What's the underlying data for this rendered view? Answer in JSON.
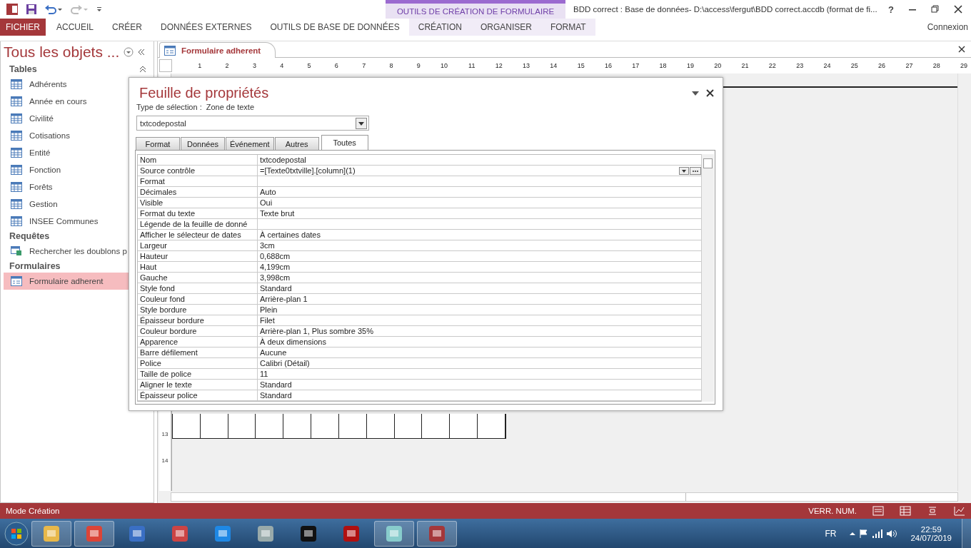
{
  "window": {
    "title": "BDD correct : Base de données- D:\\access\\fergut\\BDD correct.accdb (format de fi...",
    "help": "?",
    "account": "Connexion"
  },
  "ribbon": {
    "contextual_group": "OUTILS DE CRÉATION DE FORMULAIRE",
    "tabs": [
      {
        "label": "FICHIER",
        "kind": "file"
      },
      {
        "label": "ACCUEIL",
        "kind": "normal"
      },
      {
        "label": "CRÉER",
        "kind": "normal"
      },
      {
        "label": "DONNÉES EXTERNES",
        "kind": "normal"
      },
      {
        "label": "OUTILS DE BASE DE DONNÉES",
        "kind": "normal"
      },
      {
        "label": "CRÉATION",
        "kind": "contextual"
      },
      {
        "label": "ORGANISER",
        "kind": "contextual"
      },
      {
        "label": "FORMAT",
        "kind": "contextual"
      }
    ]
  },
  "nav_pane": {
    "title": "Tous les objets ...",
    "groups": [
      {
        "label": "Tables",
        "items": [
          {
            "label": "Adhérents",
            "kind": "table",
            "selected": false
          },
          {
            "label": "Année en cours",
            "kind": "table",
            "selected": false
          },
          {
            "label": "Civilité",
            "kind": "table",
            "selected": false
          },
          {
            "label": "Cotisations",
            "kind": "table",
            "selected": false
          },
          {
            "label": "Entité",
            "kind": "table",
            "selected": false
          },
          {
            "label": "Fonction",
            "kind": "table",
            "selected": false
          },
          {
            "label": "Forêts",
            "kind": "table",
            "selected": false
          },
          {
            "label": "Gestion",
            "kind": "table",
            "selected": false
          },
          {
            "label": "INSEE Communes",
            "kind": "table",
            "selected": false
          }
        ]
      },
      {
        "label": "Requêtes",
        "items": [
          {
            "label": "Rechercher les doublons p",
            "kind": "query",
            "selected": false
          }
        ]
      },
      {
        "label": "Formulaires",
        "items": [
          {
            "label": "Formulaire adherent",
            "kind": "form",
            "selected": true
          }
        ]
      }
    ]
  },
  "document": {
    "tab": "Formulaire adherent",
    "ruler": [
      "1",
      "2",
      "3",
      "4",
      "5",
      "6",
      "7",
      "8",
      "9",
      "10",
      "11",
      "12",
      "13",
      "14",
      "15",
      "16",
      "17",
      "18",
      "19",
      "20",
      "21",
      "22",
      "23",
      "24",
      "25",
      "26",
      "27",
      "28",
      "29"
    ],
    "vertical_ruler": [
      "13",
      "14"
    ]
  },
  "property_sheet": {
    "title": "Feuille de propriétés",
    "selection_label": "Type de sélection :",
    "selection_type": "Zone de texte",
    "object": "txtcodepostal",
    "tabs": [
      {
        "label": "Format",
        "selected": false
      },
      {
        "label": "Données",
        "selected": false
      },
      {
        "label": "Événement",
        "selected": false
      },
      {
        "label": "Autres",
        "selected": false
      },
      {
        "label": "Toutes",
        "selected": true
      }
    ],
    "properties": [
      {
        "name": "Nom",
        "value": "txtcodepostal",
        "builder": false
      },
      {
        "name": "Source contrôle",
        "value": "=[Texte0txtville].[column](1)",
        "builder": true
      },
      {
        "name": "Format",
        "builder": false
      },
      {
        "name": "Décimales",
        "value": "Auto",
        "builder": false
      },
      {
        "name": "Visible",
        "value": "Oui",
        "builder": false
      },
      {
        "name": "Format du texte",
        "value": "Texte brut",
        "builder": false
      },
      {
        "name": "Légende de la feuille de donné",
        "builder": false
      },
      {
        "name": "Afficher le sélecteur de dates",
        "value": "À certaines dates",
        "builder": false
      },
      {
        "name": "Largeur",
        "value": "3cm",
        "builder": false
      },
      {
        "name": "Hauteur",
        "value": "0,688cm",
        "builder": false
      },
      {
        "name": "Haut",
        "value": "4,199cm",
        "builder": false
      },
      {
        "name": "Gauche",
        "value": "3,998cm",
        "builder": false
      },
      {
        "name": "Style fond",
        "value": "Standard",
        "builder": false
      },
      {
        "name": "Couleur fond",
        "value": "Arrière-plan 1",
        "builder": false
      },
      {
        "name": "Style bordure",
        "value": "Plein",
        "builder": false
      },
      {
        "name": "Épaisseur bordure",
        "value": "Filet",
        "builder": false
      },
      {
        "name": "Couleur bordure",
        "value": "Arrière-plan 1, Plus sombre 35%",
        "builder": false
      },
      {
        "name": "Apparence",
        "value": "À deux dimensions",
        "builder": false
      },
      {
        "name": "Barre défilement",
        "value": "Aucune",
        "builder": false
      },
      {
        "name": "Police",
        "value": "Calibri (Détail)",
        "builder": false
      },
      {
        "name": "Taille de police",
        "value": "11",
        "builder": false
      },
      {
        "name": "Aligner le texte",
        "value": "Standard",
        "builder": false
      },
      {
        "name": "Épaisseur police",
        "value": "Standard",
        "builder": false
      }
    ]
  },
  "status_bar": {
    "mode": "Mode Création",
    "indicator": "VERR. NUM."
  },
  "taskbar": {
    "language": "FR",
    "time": "22:59",
    "date": "24/07/2019"
  }
}
